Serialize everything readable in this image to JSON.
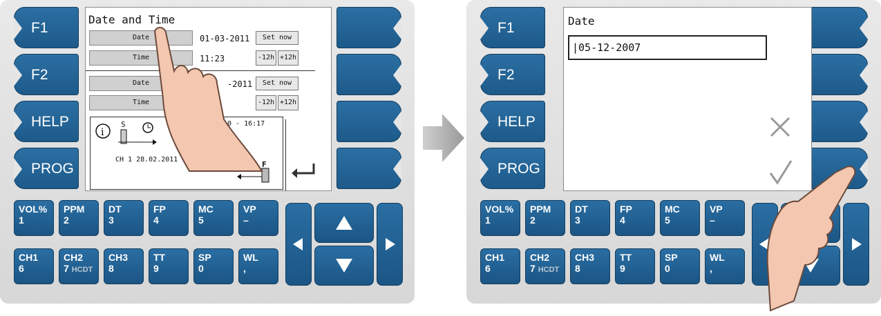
{
  "softkeys": [
    "F1",
    "F2",
    "HELP",
    "PROG"
  ],
  "left_screen": {
    "title": "Date and Time",
    "date_label": "Date",
    "time_label": "Time",
    "date_value_1": "01-03-2011",
    "time_value_1": "11:23",
    "date_value_2": "-2011",
    "set_now": "Set now",
    "minus12": "-12h",
    "plus12": "+12h",
    "info_datetime": "10 - 16:17",
    "info_channel": "CH 1  28.02.2011 -",
    "info_s": "S",
    "info_f": "F"
  },
  "right_screen": {
    "title": "Date",
    "input_value": "05-12-2007"
  },
  "keypad_row1": [
    {
      "top": "VOL%",
      "bottom": "1"
    },
    {
      "top": "PPM",
      "bottom": "2"
    },
    {
      "top": "DT",
      "bottom": "3"
    },
    {
      "top": "FP",
      "bottom": "4"
    },
    {
      "top": "MC",
      "bottom": "5"
    },
    {
      "top": "VP",
      "bottom": "–"
    }
  ],
  "keypad_row2": [
    {
      "top": "CH1",
      "bottom": "6",
      "extra": ""
    },
    {
      "top": "CH2",
      "bottom": "7",
      "extra": "HCDT"
    },
    {
      "top": "CH3",
      "bottom": "8",
      "extra": ""
    },
    {
      "top": "TT",
      "bottom": "9",
      "extra": ""
    },
    {
      "top": "SP",
      "bottom": "0",
      "extra": ""
    },
    {
      "top": "WL",
      "bottom": ",",
      "extra": ""
    }
  ],
  "icons": [
    "up-arrow",
    "down-arrow",
    "left-arrow",
    "right-arrow",
    "cancel-x",
    "confirm-check",
    "return-arrow",
    "info",
    "clock",
    "pointing-hand"
  ]
}
